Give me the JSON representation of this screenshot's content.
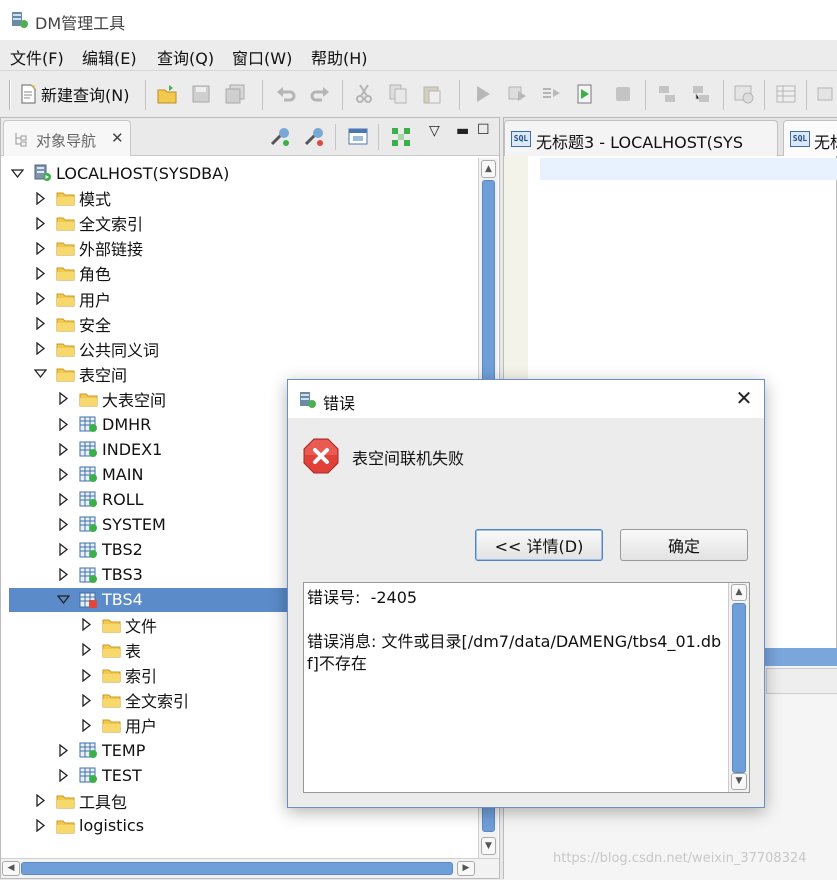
{
  "window": {
    "title": "DM管理工具"
  },
  "menu": [
    "文件(F)",
    "编辑(E)",
    "查询(Q)",
    "窗口(W)",
    "帮助(H)"
  ],
  "toolbar": {
    "new_query_label": "新建查询(N)"
  },
  "navigator": {
    "tab_label": "对象导航",
    "tab_close": "✕",
    "tree": [
      {
        "label": "LOCALHOST(SYSDBA)",
        "level": 0,
        "expanded": true,
        "icon": "server-icon"
      },
      {
        "label": "模式",
        "level": 1,
        "expanded": false,
        "icon": "folder-icon"
      },
      {
        "label": "全文索引",
        "level": 1,
        "expanded": false,
        "icon": "folder-icon"
      },
      {
        "label": "外部链接",
        "level": 1,
        "expanded": false,
        "icon": "folder-icon"
      },
      {
        "label": "角色",
        "level": 1,
        "expanded": false,
        "icon": "folder-icon"
      },
      {
        "label": "用户",
        "level": 1,
        "expanded": false,
        "icon": "folder-icon"
      },
      {
        "label": "安全",
        "level": 1,
        "expanded": false,
        "icon": "folder-icon"
      },
      {
        "label": "公共同义词",
        "level": 1,
        "expanded": false,
        "icon": "folder-icon"
      },
      {
        "label": "表空间",
        "level": 1,
        "expanded": true,
        "icon": "folder-icon"
      },
      {
        "label": "大表空间",
        "level": 2,
        "expanded": false,
        "icon": "folder-icon"
      },
      {
        "label": "DMHR",
        "level": 2,
        "expanded": false,
        "icon": "tablespace-icon"
      },
      {
        "label": "INDEX1",
        "level": 2,
        "expanded": false,
        "icon": "tablespace-icon"
      },
      {
        "label": "MAIN",
        "level": 2,
        "expanded": false,
        "icon": "tablespace-icon"
      },
      {
        "label": "ROLL",
        "level": 2,
        "expanded": false,
        "icon": "tablespace-icon"
      },
      {
        "label": "SYSTEM",
        "level": 2,
        "expanded": false,
        "icon": "tablespace-icon"
      },
      {
        "label": "TBS2",
        "level": 2,
        "expanded": false,
        "icon": "tablespace-icon"
      },
      {
        "label": "TBS3",
        "level": 2,
        "expanded": false,
        "icon": "tablespace-icon"
      },
      {
        "label": "TBS4",
        "level": 2,
        "expanded": true,
        "icon": "tablespace-offline-icon",
        "selected": true
      },
      {
        "label": "文件",
        "level": 3,
        "expanded": false,
        "icon": "folder-icon"
      },
      {
        "label": "表",
        "level": 3,
        "expanded": false,
        "icon": "folder-icon"
      },
      {
        "label": "索引",
        "level": 3,
        "expanded": false,
        "icon": "folder-icon"
      },
      {
        "label": "全文索引",
        "level": 3,
        "expanded": false,
        "icon": "folder-icon"
      },
      {
        "label": "用户",
        "level": 3,
        "expanded": false,
        "icon": "folder-icon"
      },
      {
        "label": "TEMP",
        "level": 2,
        "expanded": false,
        "icon": "tablespace-icon"
      },
      {
        "label": "TEST",
        "level": 2,
        "expanded": false,
        "icon": "tablespace-icon"
      },
      {
        "label": "工具包",
        "level": 1,
        "expanded": false,
        "icon": "folder-icon"
      },
      {
        "label": "logistics",
        "level": 1,
        "expanded": false,
        "icon": "folder-icon"
      }
    ]
  },
  "editor": {
    "tabs": [
      {
        "label": "无标题3 - LOCALHOST(SYS",
        "active": true
      },
      {
        "label": "无标",
        "active": false
      }
    ]
  },
  "dialog": {
    "title": "错误",
    "message": "表空间联机失败",
    "details_button": "<< 详情(D)",
    "ok_button": "确定",
    "detail_text": "错误号:  -2405\n\n错误消息: 文件或目录[/dm7/data/DAMENG/tbs4_01.dbf]不存在"
  },
  "watermark": "https://blog.csdn.net/weixin_37708324",
  "colors": {
    "selection": "#5b8bc9",
    "scrollbar": "#6f9fd9",
    "folder": "#f2c94c"
  }
}
